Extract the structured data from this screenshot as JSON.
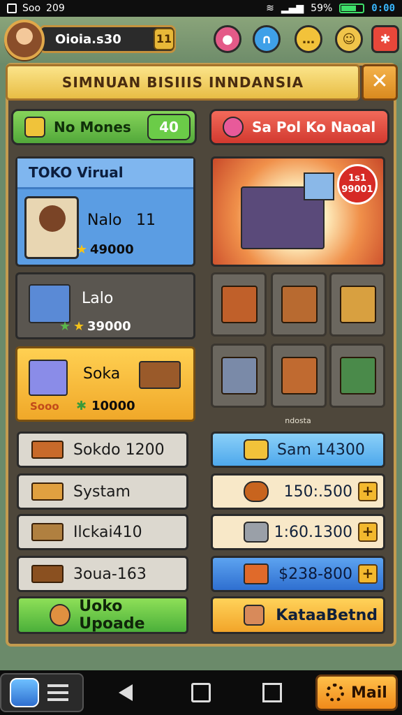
{
  "status_bar": {
    "left_text": "Soo",
    "left_num": "209",
    "battery": "59%",
    "time": "0:00"
  },
  "top": {
    "money": "Oioia.s30",
    "money_badge": "11"
  },
  "panel": {
    "title": "SIMNUAN BISIIIS INNDANSIA"
  },
  "tabs": {
    "left": {
      "label": "No Mones",
      "badge": "40"
    },
    "right": {
      "label": "Sa Pol Ko Naoal"
    }
  },
  "left_cards": {
    "featured": {
      "header": "TOKO Virual",
      "name": "Nalo",
      "level": "11",
      "price": "49000"
    },
    "item1": {
      "name": "Lalo",
      "price": "39000"
    },
    "item2": {
      "name": "Soka",
      "extra": "Sooo",
      "price": "10000"
    }
  },
  "left_rows": [
    {
      "label": "Sokdo 1200"
    },
    {
      "label": "Systam"
    },
    {
      "label": "Ilckai410"
    },
    {
      "label": "3oua-163"
    }
  ],
  "left_action": {
    "label": "Uoko Upoade"
  },
  "scene": {
    "badge_line1": "1s1",
    "badge_line2": "99001"
  },
  "grid_caption": "ndosta",
  "right_rows": [
    {
      "label": "Sam 14300",
      "style": "skyblue"
    },
    {
      "label": "150:.500",
      "style": "cream"
    },
    {
      "label": "1:60.1300",
      "style": "cream"
    },
    {
      "label": "$238-800",
      "style": "blue"
    }
  ],
  "right_action": {
    "label": "KataaBetnd"
  },
  "bottom_nav": {
    "mail_label": "Mail"
  }
}
